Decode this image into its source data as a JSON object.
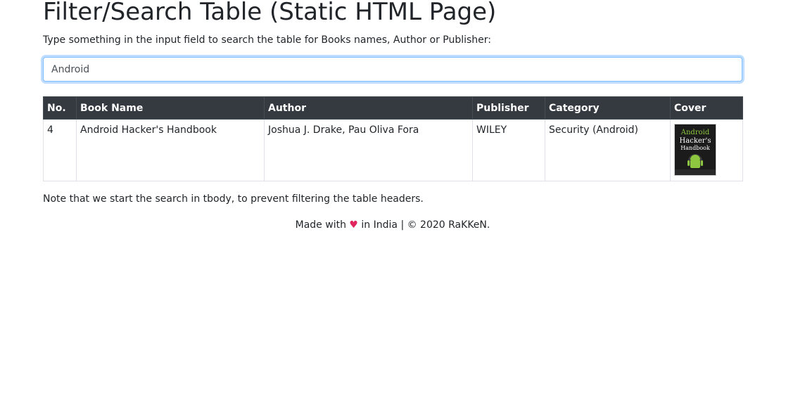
{
  "page": {
    "title": "Filter/Search Table (Static HTML Page)",
    "intro": "Type something in the input field to search the table for Books names, Author or Publisher:",
    "note": "Note that we start the search in tbody, to prevent filtering the table headers."
  },
  "search": {
    "value": "Android"
  },
  "table": {
    "headers": [
      "No.",
      "Book Name",
      "Author",
      "Publisher",
      "Category",
      "Cover"
    ],
    "rows": [
      {
        "no": "4",
        "book_name": "Android Hacker's Handbook",
        "author": "Joshua J. Drake, Pau Oliva Fora",
        "publisher": "WILEY",
        "category": "Security (Android)",
        "cover_title": "Android Hacker's Handbook"
      }
    ]
  },
  "footer": {
    "made_with": "Made with",
    "heart": "♥",
    "rest": "in India | © 2020 RaKKeN."
  },
  "colors": {
    "header_bg": "#343a40",
    "accent": "#80bdff",
    "heart": "#e0245e"
  }
}
